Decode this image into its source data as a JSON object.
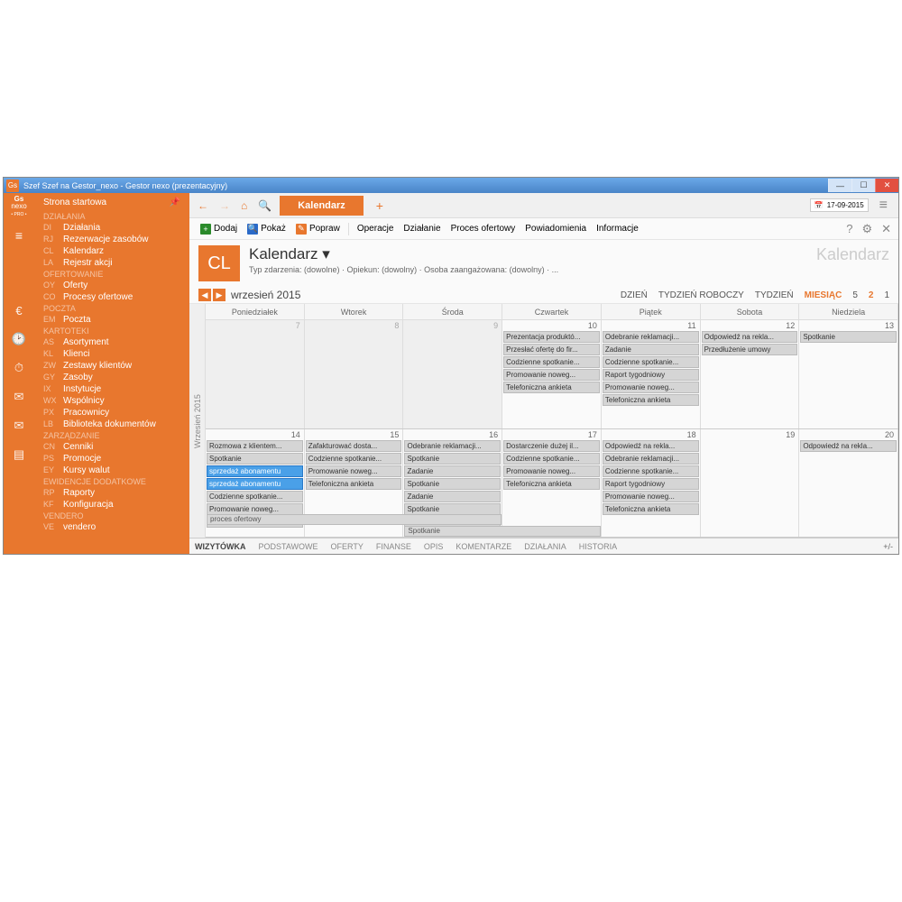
{
  "window": {
    "title": "Szef Szef na Gestor_nexo - Gestor nexo (prezentacyjny)",
    "icon": "Gs",
    "date": "17-09-2015"
  },
  "logo": {
    "l1": "Gs",
    "l2": "nexo",
    "l3": "• PRO •"
  },
  "nav": {
    "home": "Strona startowa",
    "groups": [
      {
        "label": "DZIAŁANIA",
        "items": [
          [
            "DI",
            "Działania"
          ],
          [
            "RJ",
            "Rezerwacje zasobów"
          ],
          [
            "CL",
            "Kalendarz"
          ],
          [
            "LA",
            "Rejestr akcji"
          ]
        ]
      },
      {
        "label": "OFERTOWANIE",
        "items": [
          [
            "OY",
            "Oferty"
          ],
          [
            "CO",
            "Procesy ofertowe"
          ]
        ]
      },
      {
        "label": "POCZTA",
        "items": [
          [
            "EM",
            "Poczta"
          ]
        ]
      },
      {
        "label": "KARTOTEKI",
        "items": [
          [
            "AS",
            "Asortyment"
          ],
          [
            "KL",
            "Klienci"
          ],
          [
            "ZW",
            "Zestawy klientów"
          ],
          [
            "GY",
            "Zasoby"
          ],
          [
            "IX",
            "Instytucje"
          ],
          [
            "WX",
            "Wspólnicy"
          ],
          [
            "PX",
            "Pracownicy"
          ],
          [
            "LB",
            "Biblioteka dokumentów"
          ]
        ]
      },
      {
        "label": "ZARZĄDZANIE",
        "items": [
          [
            "CN",
            "Cenniki"
          ],
          [
            "PS",
            "Promocje"
          ],
          [
            "EY",
            "Kursy walut"
          ]
        ]
      },
      {
        "label": "EWIDENCJE DODATKOWE",
        "items": [
          [
            "RP",
            "Raporty"
          ],
          [
            "KF",
            "Konfiguracja"
          ]
        ]
      },
      {
        "label": "VENDERO",
        "items": [
          [
            "VE",
            "vendero"
          ]
        ]
      }
    ]
  },
  "tab": "Kalendarz",
  "toolbar": {
    "add": "Dodaj",
    "show": "Pokaż",
    "edit": "Popraw",
    "ops": "Operacje",
    "act": "Działanie",
    "proc": "Proces ofertowy",
    "notif": "Powiadomienia",
    "info": "Informacje"
  },
  "header": {
    "badge": "CL",
    "title": "Kalendarz ▾",
    "sub": "Typ zdarzenia: (dowolne) · Opiekun: (dowolny) · Osoba zaangażowana: (dowolny) · ...",
    "ghost": "Kalendarz"
  },
  "viewbar": {
    "month": "wrzesień 2015",
    "views": [
      "DZIEŃ",
      "TYDZIEŃ ROBOCZY",
      "TYDZIEŃ",
      "MIESIĄC",
      "5",
      "2",
      "1"
    ],
    "rot": "Wrzesień 2015"
  },
  "days": [
    "Poniedziałek",
    "Wtorek",
    "Środa",
    "Czwartek",
    "Piątek",
    "Sobota",
    "Niedziela"
  ],
  "w1": {
    "nums": [
      "7",
      "8",
      "9",
      "10",
      "11",
      "12",
      "13"
    ],
    "e10": [
      "Prezentacja produktó...",
      "Przesłać ofertę do fir...",
      "Codzienne spotkanie...",
      "Promowanie noweg...",
      "Telefoniczna ankieta"
    ],
    "e11": [
      "Odebranie reklamacji...",
      "Zadanie",
      "Codzienne spotkanie...",
      "Raport tygodniowy",
      "Promowanie noweg...",
      "Telefoniczna ankieta"
    ],
    "e12": [
      "Odpowiedź na rekla...",
      "Przedłużenie umowy"
    ],
    "e13": [
      "Spotkanie"
    ]
  },
  "w2": {
    "nums": [
      "14",
      "15",
      "16",
      "17",
      "18",
      "19",
      "20"
    ],
    "e14": [
      "Rozmowa z klientem...",
      "Spotkanie",
      {
        "t": "sprzedaż abonamentu",
        "c": "bl"
      },
      {
        "t": "sprzedaż abonamentu",
        "c": "bl"
      },
      "Codzienne spotkanie...",
      "Promowanie noweg...",
      "Telefoniczna ankieta"
    ],
    "e15": [
      "Zafakturować dosta...",
      "Codzienne spotkanie...",
      "Promowanie noweg...",
      "Telefoniczna ankieta"
    ],
    "e16": [
      "Odebranie reklamacji...",
      "Spotkanie",
      "Zadanie",
      "Spotkanie",
      "Zadanie",
      "Spotkanie",
      "Zadanie"
    ],
    "e17": [
      "Dostarczenie dużej il...",
      "Codzienne spotkanie...",
      "Promowanie noweg...",
      "Telefoniczna ankieta"
    ],
    "e18": [
      "Odpowiedź na rekla...",
      "Odebranie reklamacji...",
      "Codzienne spotkanie...",
      "Raport tygodniowy",
      "Promowanie noweg...",
      "Telefoniczna ankieta"
    ],
    "e20": [
      "Odpowiedź na rekla..."
    ],
    "span1": "proces ofertowy",
    "span2": "Spotkanie"
  },
  "bottabs": [
    "WIZYTÓWKA",
    "PODSTAWOWE",
    "OFERTY",
    "FINANSE",
    "OPIS",
    "KOMENTARZE",
    "DZIAŁANIA",
    "HISTORIA"
  ]
}
